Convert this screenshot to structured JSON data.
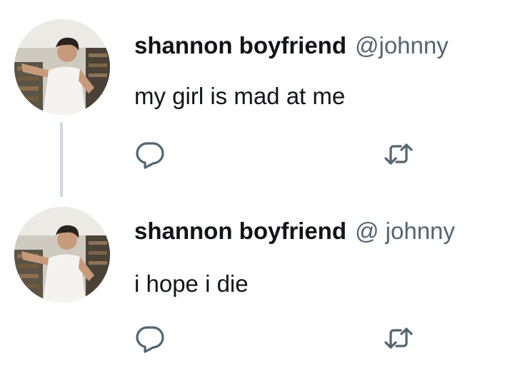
{
  "colors": {
    "text_primary": "#0f1419",
    "text_secondary": "#536471",
    "thread_line": "#cfd9de",
    "icon": "#536471"
  },
  "tweets": [
    {
      "display_name": "shannon boyfriend",
      "handle": "@johnny",
      "text": "my girl is mad at me",
      "avatar_icon": "profile-photo",
      "actions": [
        {
          "icon": "reply-icon"
        },
        {
          "icon": "retweet-icon"
        }
      ]
    },
    {
      "display_name": "shannon boyfriend",
      "handle": "@ johnny",
      "text": "i hope i die",
      "avatar_icon": "profile-photo",
      "actions": [
        {
          "icon": "reply-icon"
        },
        {
          "icon": "retweet-icon"
        }
      ]
    }
  ]
}
